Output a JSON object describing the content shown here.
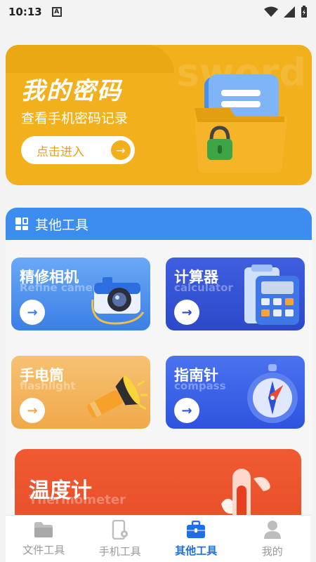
{
  "status_bar": {
    "time": "10:13",
    "notif_icon": "A"
  },
  "password_card": {
    "title": "我的密码",
    "subtitle": "查看手机密码记录",
    "button_label": "点击进入",
    "bg_word": "sword",
    "accent": "#f2b01c"
  },
  "section": {
    "title": "其他工具",
    "accent": "#3d8cf0"
  },
  "tools": [
    {
      "title": "精修相机",
      "en": "Refine camera",
      "icon": "camera-icon"
    },
    {
      "title": "计算器",
      "en": "calculator",
      "icon": "calculator-icon"
    },
    {
      "title": "手电筒",
      "en": "flashlight",
      "icon": "flashlight-icon"
    },
    {
      "title": "指南针",
      "en": "compass",
      "icon": "compass-icon"
    },
    {
      "title": "温度计",
      "en": "Thermometer",
      "icon": "thermometer-icon"
    }
  ],
  "arrow_glyph": "→",
  "bottom_nav": [
    {
      "label": "文件工具",
      "icon": "folder-icon"
    },
    {
      "label": "手机工具",
      "icon": "phone-settings-icon"
    },
    {
      "label": "其他工具",
      "icon": "toolbox-icon",
      "active": true
    },
    {
      "label": "我的",
      "icon": "user-icon"
    }
  ]
}
